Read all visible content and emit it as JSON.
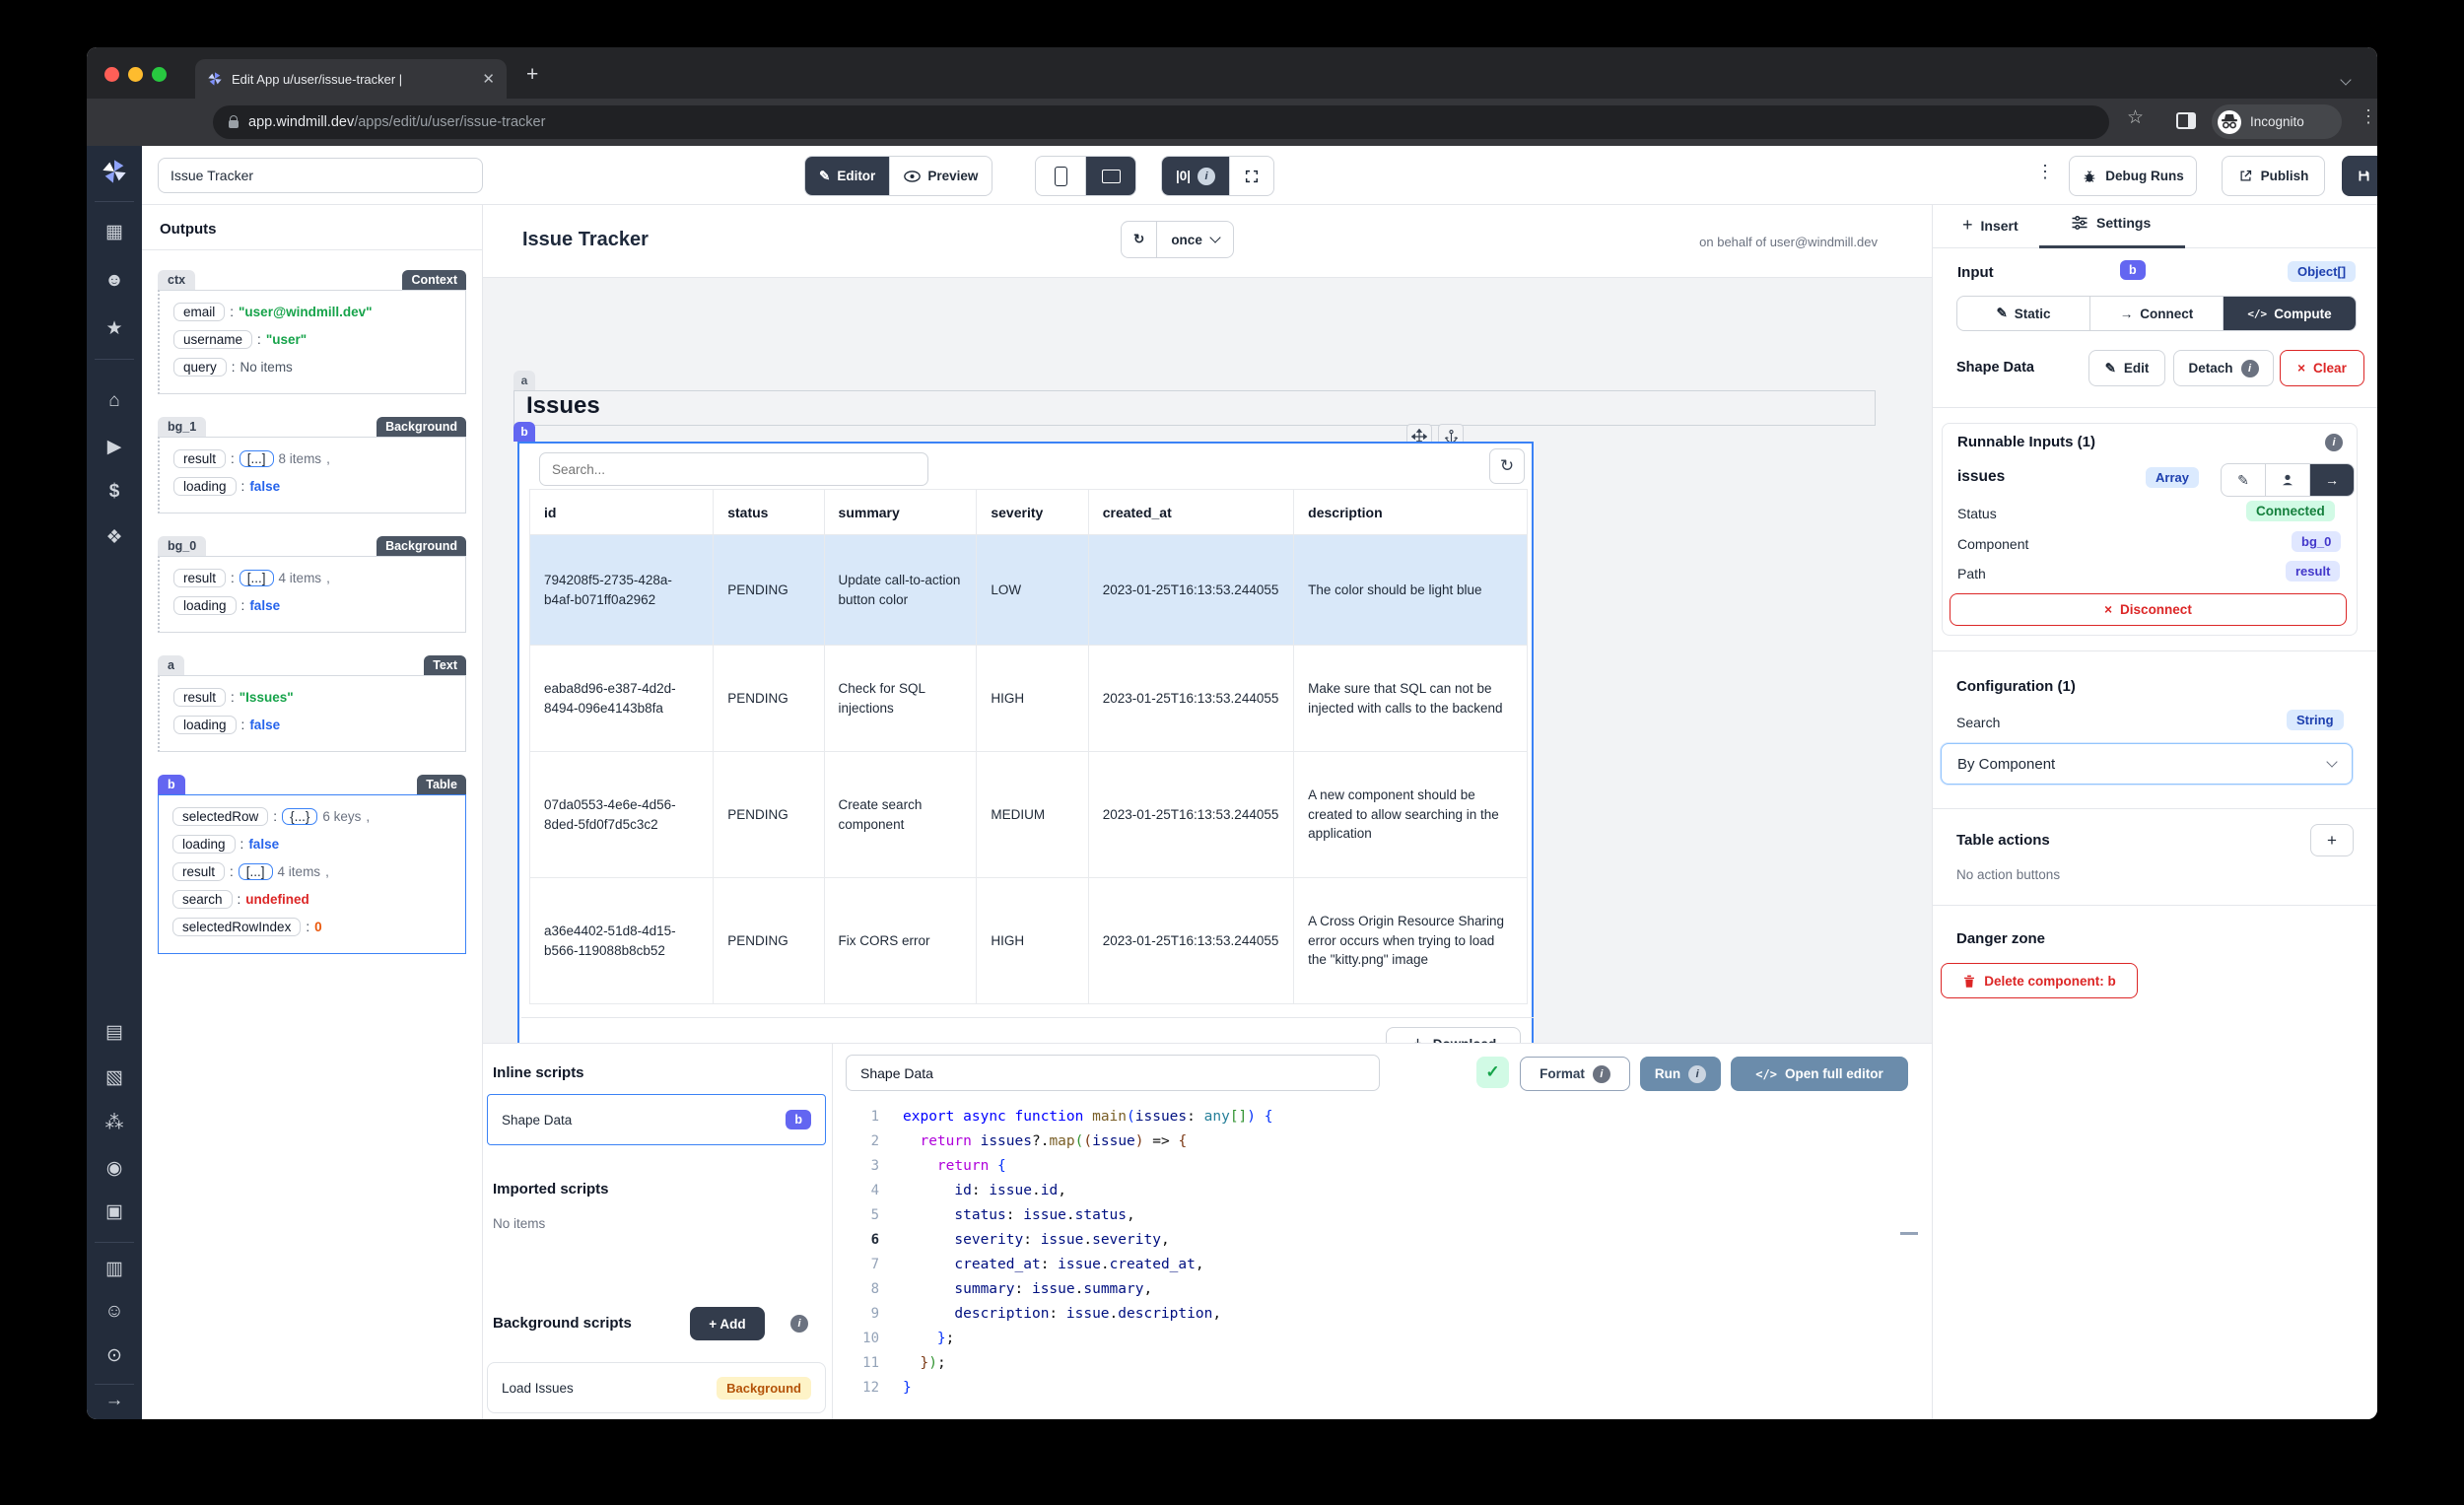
{
  "colors": {
    "accent_indigo": "#6366f1",
    "accent_blue": "#3b82f6",
    "connected_green": "#15803d",
    "danger_red": "#dc2626",
    "dark_slate": "#333c4c",
    "yellow_badge": "#b45309"
  },
  "browser": {
    "tab_title": "Edit App u/user/issue-tracker |",
    "url_host": "app.windmill.dev",
    "url_path": "/apps/edit/u/user/issue-tracker",
    "incognito_label": "Incognito"
  },
  "topbar": {
    "app_name": "Issue Tracker",
    "editor_label": "Editor",
    "preview_label": "Preview",
    "zero_label": "|0|",
    "debug_runs_label": "Debug Runs",
    "publish_label": "Publish",
    "save_label": "Save"
  },
  "outputs": {
    "title": "Outputs",
    "sections": [
      {
        "id": "ctx",
        "type": "Context",
        "selected": false,
        "rows": [
          {
            "key": "email",
            "kind": "string",
            "value": "\"user@windmill.dev\""
          },
          {
            "key": "username",
            "kind": "string",
            "value": "\"user\""
          },
          {
            "key": "query",
            "kind": "plain",
            "value": "No items"
          }
        ]
      },
      {
        "id": "bg_1",
        "type": "Background",
        "selected": false,
        "rows": [
          {
            "key": "result",
            "kind": "array",
            "bracket": "[...]",
            "count": "8 items",
            "comma": ","
          },
          {
            "key": "loading",
            "kind": "bool",
            "value": "false"
          }
        ]
      },
      {
        "id": "bg_0",
        "type": "Background",
        "selected": false,
        "rows": [
          {
            "key": "result",
            "kind": "array",
            "bracket": "[...]",
            "count": "4 items",
            "comma": ","
          },
          {
            "key": "loading",
            "kind": "bool",
            "value": "false"
          }
        ]
      },
      {
        "id": "a",
        "type": "Text",
        "selected": false,
        "rows": [
          {
            "key": "result",
            "kind": "string",
            "value": "\"Issues\""
          },
          {
            "key": "loading",
            "kind": "bool",
            "value": "false"
          }
        ]
      },
      {
        "id": "b",
        "type": "Table",
        "selected": true,
        "rows": [
          {
            "key": "selectedRow",
            "kind": "object",
            "bracket": "{...}",
            "count": "6 keys",
            "comma": ","
          },
          {
            "key": "loading",
            "kind": "bool",
            "value": "false"
          },
          {
            "key": "result",
            "kind": "array",
            "bracket": "[...]",
            "count": "4 items",
            "comma": ","
          },
          {
            "key": "search",
            "kind": "undefined",
            "value": "undefined"
          },
          {
            "key": "selectedRowIndex",
            "kind": "number",
            "value": "0"
          }
        ]
      }
    ]
  },
  "canvas": {
    "app_title": "Issue Tracker",
    "refresh_interval": "once",
    "on_behalf": "on behalf of user@windmill.dev",
    "text_component": {
      "id": "a",
      "text": "Issues"
    },
    "table": {
      "id": "b",
      "search_placeholder": "Search...",
      "columns": [
        "id",
        "status",
        "summary",
        "severity",
        "created_at",
        "description"
      ],
      "rows": [
        [
          "794208f5-2735-428a-b4af-b071ff0a2962",
          "PENDING",
          "Update call-to-action button color",
          "LOW",
          "2023-01-25T16:13:53.244055",
          "The color should be light blue"
        ],
        [
          "eaba8d96-e387-4d2d-8494-096e4143b8fa",
          "PENDING",
          "Check for SQL injections",
          "HIGH",
          "2023-01-25T16:13:53.244055",
          "Make sure that SQL can not be injected with calls to the backend"
        ],
        [
          "07da0553-4e6e-4d56-8ded-5fd0f7d5c3c2",
          "PENDING",
          "Create search component",
          "MEDIUM",
          "2023-01-25T16:13:53.244055",
          "A new component should be created to allow searching in the application"
        ],
        [
          "a36e4402-51d8-4d15-b566-119088b8cb52",
          "PENDING",
          "Fix CORS error",
          "HIGH",
          "2023-01-25T16:13:53.244055",
          "A Cross Origin Resource Sharing error occurs when trying to load the \"kitty.png\" image"
        ]
      ],
      "selected_row_index": 0,
      "download_label": "Download"
    }
  },
  "scripts_panel": {
    "inline_title": "Inline scripts",
    "inline_items": [
      {
        "label": "Shape Data",
        "badge": "b"
      }
    ],
    "imported_title": "Imported scripts",
    "imported_empty": "No items",
    "background_title": "Background scripts",
    "add_label": "+ Add",
    "background_items": [
      {
        "label": "Load Issues",
        "badge": "Background"
      }
    ]
  },
  "code_editor": {
    "name": "Shape Data",
    "check": "✓",
    "format_label": "Format",
    "run_label": "Run",
    "open_full_label": "Open full editor",
    "active_line": 6,
    "lines": [
      "export async function main(issues: any[]) {",
      "  return issues?.map((issue) => {",
      "    return {",
      "      id: issue.id,",
      "      status: issue.status,",
      "      severity: issue.severity,",
      "      created_at: issue.created_at,",
      "      summary: issue.summary,",
      "      description: issue.description,",
      "    };",
      "  });",
      "}"
    ]
  },
  "settings": {
    "insert_tab": "Insert",
    "settings_tab": "Settings",
    "input_label": "Input",
    "component_badge": "b",
    "type_badge": "Object[]",
    "mode_static": "Static",
    "mode_connect": "Connect",
    "mode_compute": "Compute",
    "runnable_name": "Shape Data",
    "edit_label": "Edit",
    "detach_label": "Detach",
    "clear_label": "Clear",
    "runnable_inputs_title": "Runnable Inputs (1)",
    "field_name": "issues",
    "field_type": "Array",
    "status_label": "Status",
    "status_value": "Connected",
    "component_label": "Component",
    "component_value": "bg_0",
    "path_label": "Path",
    "path_value": "result",
    "disconnect_label": "Disconnect",
    "configuration_title": "Configuration (1)",
    "search_label": "Search",
    "search_type": "String",
    "search_value": "By Component",
    "table_actions_title": "Table actions",
    "table_actions_empty": "No action buttons",
    "danger_title": "Danger zone",
    "delete_label": "Delete component: b"
  }
}
